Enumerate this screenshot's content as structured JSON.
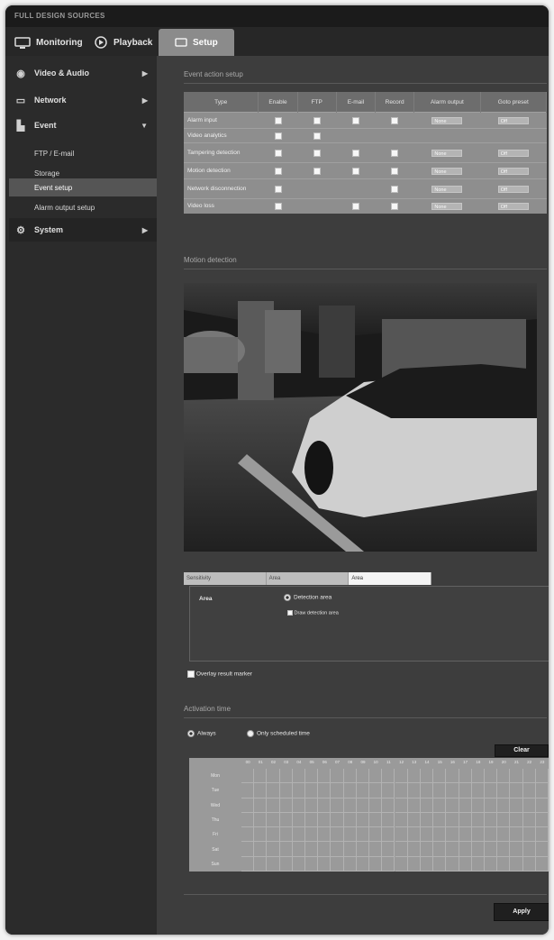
{
  "window": {
    "title": "FULL DESIGN SOURCES"
  },
  "topnav": {
    "tabs": [
      {
        "label": "Monitoring",
        "icon": "monitor-icon"
      },
      {
        "label": "Playback",
        "icon": "playback-icon"
      },
      {
        "label": "Setup",
        "icon": "setup-icon"
      }
    ],
    "active": "Setup"
  },
  "sidebar": {
    "items": [
      {
        "label": "Video & Audio",
        "icon": "camera-icon"
      },
      {
        "label": "Network",
        "icon": "network-icon"
      },
      {
        "label": "Event",
        "icon": "event-icon"
      }
    ],
    "sub_items": [
      {
        "label": "FTP / E-mail"
      },
      {
        "label": "Storage"
      },
      {
        "label": "Event setup"
      },
      {
        "label": "Alarm output setup"
      }
    ],
    "system": {
      "label": "System",
      "icon": "gear-icon"
    }
  },
  "event_setup": {
    "title": "Event action setup",
    "columns": [
      "Type",
      "Enable",
      "FTP",
      "E-mail",
      "Record",
      "Alarm output",
      "Goto preset"
    ],
    "rows": [
      {
        "name": "Alarm input",
        "checks": [
          true,
          true,
          true,
          true
        ],
        "alarm": "None",
        "preset": "Off"
      },
      {
        "name": "Video analytics",
        "checks": [
          true,
          true,
          false,
          false
        ],
        "alarm": "",
        "preset": ""
      },
      {
        "name": "Tampering detection",
        "checks": [
          true,
          true,
          true,
          true
        ],
        "alarm": "None",
        "preset": "Off"
      },
      {
        "name": "Motion detection",
        "checks": [
          true,
          true,
          true,
          true
        ],
        "alarm": "None",
        "preset": "Off"
      },
      {
        "name": "Network disconnection",
        "checks": [
          true,
          false,
          false,
          true
        ],
        "alarm": "None",
        "preset": "Off"
      },
      {
        "name": "Video loss",
        "checks": [
          true,
          false,
          true,
          true
        ],
        "alarm": "None",
        "preset": "Off"
      }
    ]
  },
  "motion": {
    "title": "Motion detection",
    "tabs": [
      "Sensitivity",
      "Area",
      "Area"
    ],
    "active_tab_index": 2,
    "area_label": "Area",
    "detection_option": "Detection area",
    "sub_option": "Draw detection area",
    "overlay_label": "Overlay result marker"
  },
  "schedule": {
    "title": "Activation time",
    "option_always": "Always",
    "option_scheduled": "Only scheduled time",
    "selected": "Always",
    "clear_label": "Clear",
    "days": [
      "Mon",
      "Tue",
      "Wed",
      "Thu",
      "Fri",
      "Sat",
      "Sun"
    ],
    "hours": [
      "00",
      "01",
      "02",
      "03",
      "04",
      "05",
      "06",
      "07",
      "08",
      "09",
      "10",
      "11",
      "12",
      "13",
      "14",
      "15",
      "16",
      "17",
      "18",
      "19",
      "20",
      "21",
      "22",
      "23"
    ]
  },
  "apply_label": "Apply"
}
